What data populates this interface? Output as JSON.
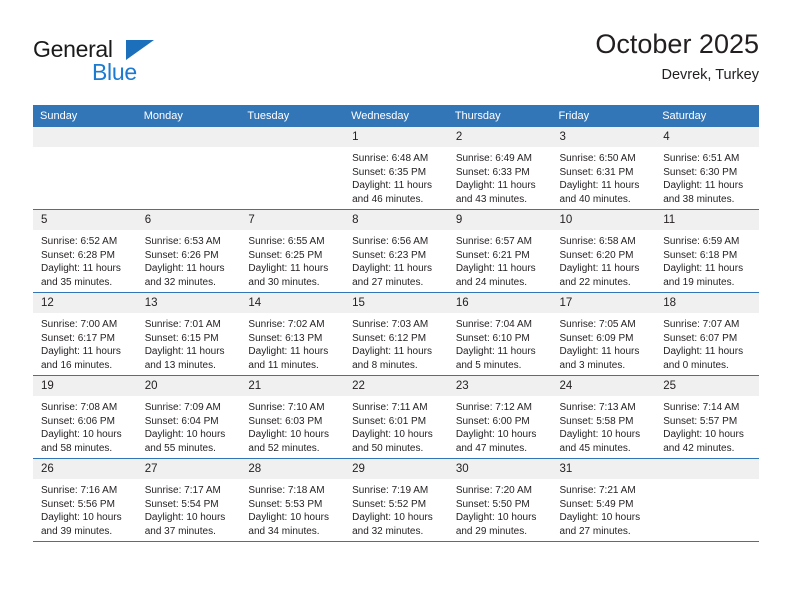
{
  "brand": {
    "name_top": "General",
    "name_bottom": "Blue",
    "accent_color": "#1c7ad1",
    "triangle_color": "#1c6fba"
  },
  "header": {
    "title": "October 2025",
    "subtitle": "Devrek, Turkey"
  },
  "theme": {
    "header_row_bg": "#3376b8",
    "daynum_bg": "#f0f0f0",
    "border_color": "#3376b8",
    "text_color": "#231f20"
  },
  "weekdays": [
    "Sunday",
    "Monday",
    "Tuesday",
    "Wednesday",
    "Thursday",
    "Friday",
    "Saturday"
  ],
  "labels": {
    "sunrise_prefix": "Sunrise:",
    "sunset_prefix": "Sunset:",
    "daylight_prefix": "Daylight:"
  },
  "weeks": [
    [
      {
        "day": "",
        "empty": true,
        "l1": "",
        "l2": "",
        "l3": "",
        "l4": ""
      },
      {
        "day": "",
        "empty": true,
        "l1": "",
        "l2": "",
        "l3": "",
        "l4": ""
      },
      {
        "day": "",
        "empty": true,
        "l1": "",
        "l2": "",
        "l3": "",
        "l4": ""
      },
      {
        "day": "1",
        "empty": false,
        "l1": "Sunrise: 6:48 AM",
        "l2": "Sunset: 6:35 PM",
        "l3": "Daylight: 11 hours",
        "l4": "and 46 minutes."
      },
      {
        "day": "2",
        "empty": false,
        "l1": "Sunrise: 6:49 AM",
        "l2": "Sunset: 6:33 PM",
        "l3": "Daylight: 11 hours",
        "l4": "and 43 minutes."
      },
      {
        "day": "3",
        "empty": false,
        "l1": "Sunrise: 6:50 AM",
        "l2": "Sunset: 6:31 PM",
        "l3": "Daylight: 11 hours",
        "l4": "and 40 minutes."
      },
      {
        "day": "4",
        "empty": false,
        "l1": "Sunrise: 6:51 AM",
        "l2": "Sunset: 6:30 PM",
        "l3": "Daylight: 11 hours",
        "l4": "and 38 minutes."
      }
    ],
    [
      {
        "day": "5",
        "empty": false,
        "l1": "Sunrise: 6:52 AM",
        "l2": "Sunset: 6:28 PM",
        "l3": "Daylight: 11 hours",
        "l4": "and 35 minutes."
      },
      {
        "day": "6",
        "empty": false,
        "l1": "Sunrise: 6:53 AM",
        "l2": "Sunset: 6:26 PM",
        "l3": "Daylight: 11 hours",
        "l4": "and 32 minutes."
      },
      {
        "day": "7",
        "empty": false,
        "l1": "Sunrise: 6:55 AM",
        "l2": "Sunset: 6:25 PM",
        "l3": "Daylight: 11 hours",
        "l4": "and 30 minutes."
      },
      {
        "day": "8",
        "empty": false,
        "l1": "Sunrise: 6:56 AM",
        "l2": "Sunset: 6:23 PM",
        "l3": "Daylight: 11 hours",
        "l4": "and 27 minutes."
      },
      {
        "day": "9",
        "empty": false,
        "l1": "Sunrise: 6:57 AM",
        "l2": "Sunset: 6:21 PM",
        "l3": "Daylight: 11 hours",
        "l4": "and 24 minutes."
      },
      {
        "day": "10",
        "empty": false,
        "l1": "Sunrise: 6:58 AM",
        "l2": "Sunset: 6:20 PM",
        "l3": "Daylight: 11 hours",
        "l4": "and 22 minutes."
      },
      {
        "day": "11",
        "empty": false,
        "l1": "Sunrise: 6:59 AM",
        "l2": "Sunset: 6:18 PM",
        "l3": "Daylight: 11 hours",
        "l4": "and 19 minutes."
      }
    ],
    [
      {
        "day": "12",
        "empty": false,
        "l1": "Sunrise: 7:00 AM",
        "l2": "Sunset: 6:17 PM",
        "l3": "Daylight: 11 hours",
        "l4": "and 16 minutes."
      },
      {
        "day": "13",
        "empty": false,
        "l1": "Sunrise: 7:01 AM",
        "l2": "Sunset: 6:15 PM",
        "l3": "Daylight: 11 hours",
        "l4": "and 13 minutes."
      },
      {
        "day": "14",
        "empty": false,
        "l1": "Sunrise: 7:02 AM",
        "l2": "Sunset: 6:13 PM",
        "l3": "Daylight: 11 hours",
        "l4": "and 11 minutes."
      },
      {
        "day": "15",
        "empty": false,
        "l1": "Sunrise: 7:03 AM",
        "l2": "Sunset: 6:12 PM",
        "l3": "Daylight: 11 hours",
        "l4": "and 8 minutes."
      },
      {
        "day": "16",
        "empty": false,
        "l1": "Sunrise: 7:04 AM",
        "l2": "Sunset: 6:10 PM",
        "l3": "Daylight: 11 hours",
        "l4": "and 5 minutes."
      },
      {
        "day": "17",
        "empty": false,
        "l1": "Sunrise: 7:05 AM",
        "l2": "Sunset: 6:09 PM",
        "l3": "Daylight: 11 hours",
        "l4": "and 3 minutes."
      },
      {
        "day": "18",
        "empty": false,
        "l1": "Sunrise: 7:07 AM",
        "l2": "Sunset: 6:07 PM",
        "l3": "Daylight: 11 hours",
        "l4": "and 0 minutes."
      }
    ],
    [
      {
        "day": "19",
        "empty": false,
        "l1": "Sunrise: 7:08 AM",
        "l2": "Sunset: 6:06 PM",
        "l3": "Daylight: 10 hours",
        "l4": "and 58 minutes."
      },
      {
        "day": "20",
        "empty": false,
        "l1": "Sunrise: 7:09 AM",
        "l2": "Sunset: 6:04 PM",
        "l3": "Daylight: 10 hours",
        "l4": "and 55 minutes."
      },
      {
        "day": "21",
        "empty": false,
        "l1": "Sunrise: 7:10 AM",
        "l2": "Sunset: 6:03 PM",
        "l3": "Daylight: 10 hours",
        "l4": "and 52 minutes."
      },
      {
        "day": "22",
        "empty": false,
        "l1": "Sunrise: 7:11 AM",
        "l2": "Sunset: 6:01 PM",
        "l3": "Daylight: 10 hours",
        "l4": "and 50 minutes."
      },
      {
        "day": "23",
        "empty": false,
        "l1": "Sunrise: 7:12 AM",
        "l2": "Sunset: 6:00 PM",
        "l3": "Daylight: 10 hours",
        "l4": "and 47 minutes."
      },
      {
        "day": "24",
        "empty": false,
        "l1": "Sunrise: 7:13 AM",
        "l2": "Sunset: 5:58 PM",
        "l3": "Daylight: 10 hours",
        "l4": "and 45 minutes."
      },
      {
        "day": "25",
        "empty": false,
        "l1": "Sunrise: 7:14 AM",
        "l2": "Sunset: 5:57 PM",
        "l3": "Daylight: 10 hours",
        "l4": "and 42 minutes."
      }
    ],
    [
      {
        "day": "26",
        "empty": false,
        "l1": "Sunrise: 7:16 AM",
        "l2": "Sunset: 5:56 PM",
        "l3": "Daylight: 10 hours",
        "l4": "and 39 minutes."
      },
      {
        "day": "27",
        "empty": false,
        "l1": "Sunrise: 7:17 AM",
        "l2": "Sunset: 5:54 PM",
        "l3": "Daylight: 10 hours",
        "l4": "and 37 minutes."
      },
      {
        "day": "28",
        "empty": false,
        "l1": "Sunrise: 7:18 AM",
        "l2": "Sunset: 5:53 PM",
        "l3": "Daylight: 10 hours",
        "l4": "and 34 minutes."
      },
      {
        "day": "29",
        "empty": false,
        "l1": "Sunrise: 7:19 AM",
        "l2": "Sunset: 5:52 PM",
        "l3": "Daylight: 10 hours",
        "l4": "and 32 minutes."
      },
      {
        "day": "30",
        "empty": false,
        "l1": "Sunrise: 7:20 AM",
        "l2": "Sunset: 5:50 PM",
        "l3": "Daylight: 10 hours",
        "l4": "and 29 minutes."
      },
      {
        "day": "31",
        "empty": false,
        "l1": "Sunrise: 7:21 AM",
        "l2": "Sunset: 5:49 PM",
        "l3": "Daylight: 10 hours",
        "l4": "and 27 minutes."
      },
      {
        "day": "",
        "empty": true,
        "l1": "",
        "l2": "",
        "l3": "",
        "l4": ""
      }
    ]
  ]
}
